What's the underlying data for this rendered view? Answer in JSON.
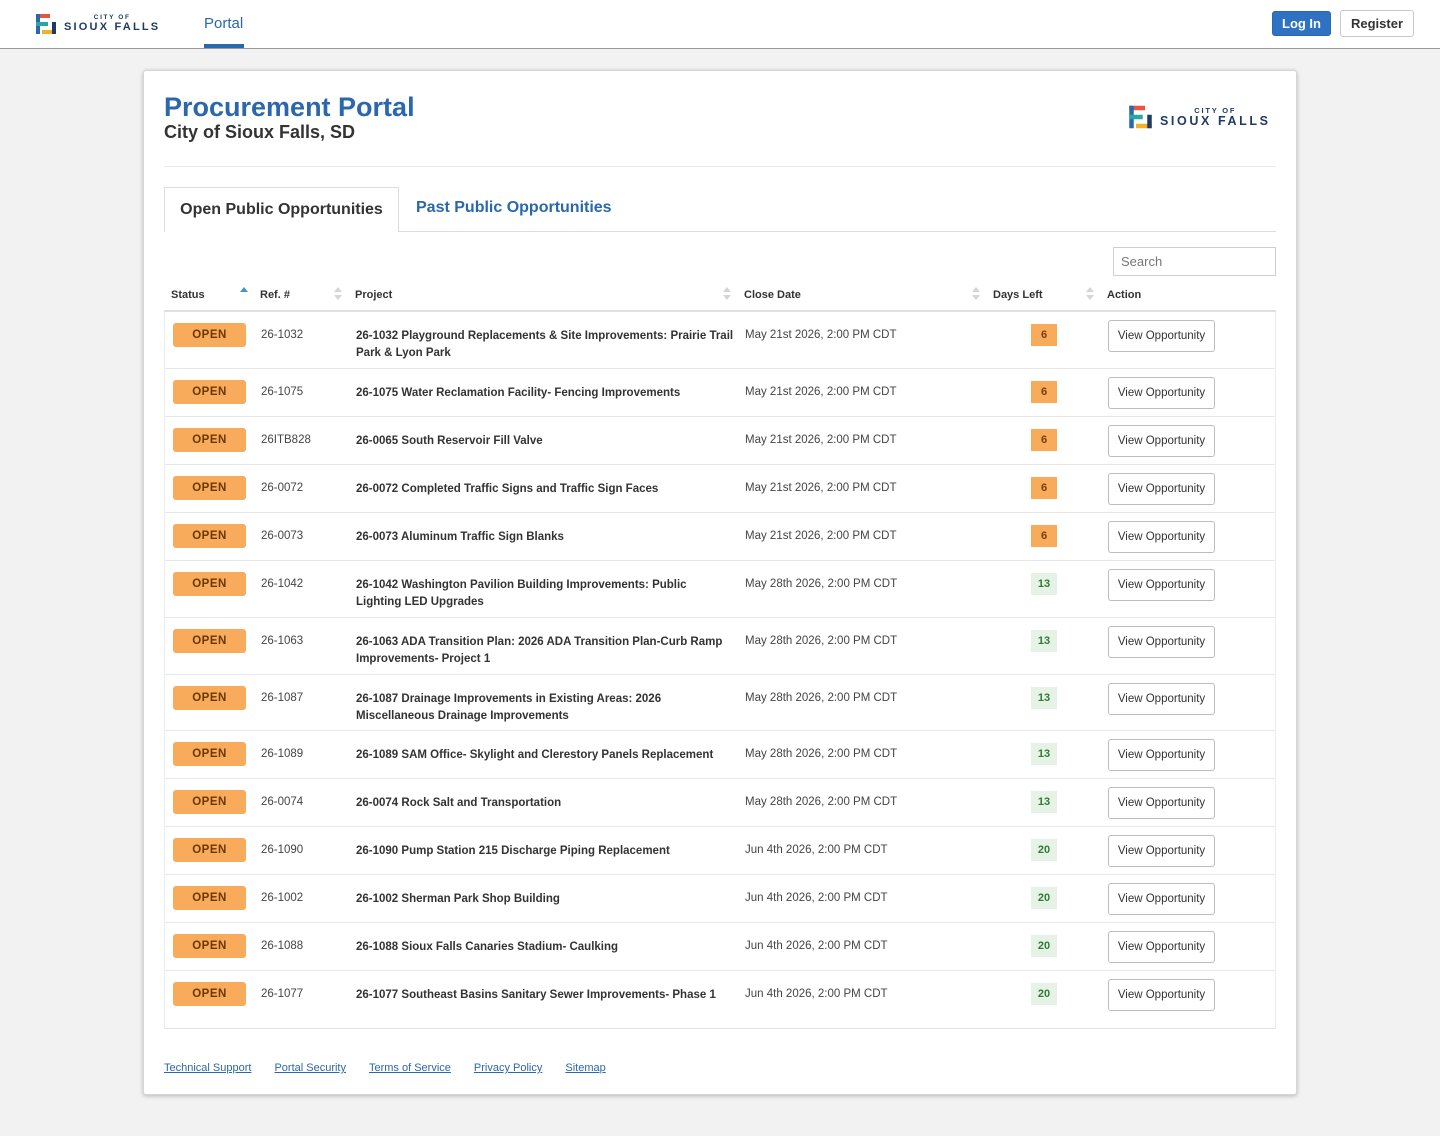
{
  "header": {
    "logo_small": "CITY OF",
    "logo_big": "SIOUX FALLS",
    "nav_tab": "Portal",
    "login_label": "Log In",
    "register_label": "Register"
  },
  "page": {
    "title": "Procurement Portal",
    "subtitle": "City of Sioux Falls, SD",
    "logo_small": "CITY OF",
    "logo_big": "SIOUX FALLS"
  },
  "tabs": {
    "open_label": "Open Public Opportunities",
    "past_label": "Past Public Opportunities"
  },
  "search": {
    "placeholder": "Search"
  },
  "table": {
    "columns": {
      "status": "Status",
      "ref": "Ref. #",
      "project": "Project",
      "close_date": "Close Date",
      "days_left": "Days Left",
      "action": "Action"
    },
    "rows": [
      {
        "status": "OPEN",
        "ref": "26-1032",
        "project": "26-1032 Playground Replacements & Site Improvements: Prairie Trail Park & Lyon Park",
        "close": "May 21st 2026, 2:00 PM CDT",
        "days": "6",
        "action": "View Opportunity"
      },
      {
        "status": "OPEN",
        "ref": "26-1075",
        "project": "26-1075 Water Reclamation Facility- Fencing Improvements",
        "close": "May 21st 2026, 2:00 PM CDT",
        "days": "6",
        "action": "View Opportunity"
      },
      {
        "status": "OPEN",
        "ref": "26ITB828",
        "project": "26-0065 South Reservoir Fill Valve",
        "close": "May 21st 2026, 2:00 PM CDT",
        "days": "6",
        "action": "View Opportunity"
      },
      {
        "status": "OPEN",
        "ref": "26-0072",
        "project": "26-0072 Completed Traffic Signs and Traffic Sign Faces",
        "close": "May 21st 2026, 2:00 PM CDT",
        "days": "6",
        "action": "View Opportunity"
      },
      {
        "status": "OPEN",
        "ref": "26-0073",
        "project": "26-0073 Aluminum Traffic Sign Blanks",
        "close": "May 21st 2026, 2:00 PM CDT",
        "days": "6",
        "action": "View Opportunity"
      },
      {
        "status": "OPEN",
        "ref": "26-1042",
        "project": "26-1042 Washington Pavilion Building Improvements: Public Lighting LED Upgrades",
        "close": "May 28th 2026, 2:00 PM CDT",
        "days": "13",
        "action": "View Opportunity"
      },
      {
        "status": "OPEN",
        "ref": "26-1063",
        "project": "26-1063 ADA Transition Plan: 2026 ADA Transition Plan-Curb Ramp Improvements- Project 1",
        "close": "May 28th 2026, 2:00 PM CDT",
        "days": "13",
        "action": "View Opportunity"
      },
      {
        "status": "OPEN",
        "ref": "26-1087",
        "project": "26-1087 Drainage Improvements in Existing Areas: 2026 Miscellaneous Drainage Improvements",
        "close": "May 28th 2026, 2:00 PM CDT",
        "days": "13",
        "action": "View Opportunity"
      },
      {
        "status": "OPEN",
        "ref": "26-1089",
        "project": "26-1089 SAM Office- Skylight and Clerestory Panels Replacement",
        "close": "May 28th 2026, 2:00 PM CDT",
        "days": "13",
        "action": "View Opportunity"
      },
      {
        "status": "OPEN",
        "ref": "26-0074",
        "project": "26-0074 Rock Salt and Transportation",
        "close": "May 28th 2026, 2:00 PM CDT",
        "days": "13",
        "action": "View Opportunity"
      },
      {
        "status": "OPEN",
        "ref": "26-1090",
        "project": "26-1090 Pump Station 215 Discharge Piping Replacement",
        "close": "Jun 4th 2026, 2:00 PM CDT",
        "days": "20",
        "action": "View Opportunity"
      },
      {
        "status": "OPEN",
        "ref": "26-1002",
        "project": "26-1002 Sherman Park Shop Building",
        "close": "Jun 4th 2026, 2:00 PM CDT",
        "days": "20",
        "action": "View Opportunity"
      },
      {
        "status": "OPEN",
        "ref": "26-1088",
        "project": "26-1088 Sioux Falls Canaries Stadium- Caulking",
        "close": "Jun 4th 2026, 2:00 PM CDT",
        "days": "20",
        "action": "View Opportunity"
      },
      {
        "status": "OPEN",
        "ref": "26-1077",
        "project": "26-1077 Southeast Basins Sanitary Sewer Improvements- Phase 1",
        "close": "Jun 4th 2026, 2:00 PM CDT",
        "days": "20",
        "action": "View Opportunity"
      }
    ]
  },
  "footer": {
    "links": [
      "Technical Support",
      "Portal Security",
      "Terms of Service",
      "Privacy Policy",
      "Sitemap"
    ]
  },
  "colors": {
    "brand_blue": "#2a67ad",
    "open_badge": "#f7ab5b",
    "days_warn": "#f7ab5b",
    "days_ok_bg": "#e6f2e6",
    "days_ok_text": "#2e7d32"
  }
}
